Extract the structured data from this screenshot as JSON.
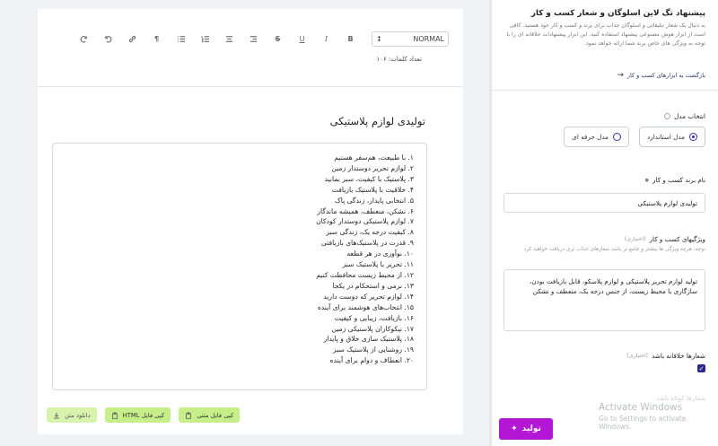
{
  "editor": {
    "toolbar": {
      "format_value": "NORMAL",
      "format_caret": "↕",
      "buttons": [
        {
          "name": "bold-button",
          "glyph": "B"
        },
        {
          "name": "italic-button",
          "glyph": "I"
        },
        {
          "name": "underline-button",
          "glyph": "U"
        },
        {
          "name": "strike-button",
          "glyph": "S"
        },
        {
          "name": "align-right-button",
          "glyph": "≡"
        },
        {
          "name": "align-center-button",
          "glyph": "≡"
        },
        {
          "name": "ordered-list-button",
          "glyph": "☰"
        },
        {
          "name": "bullet-list-button",
          "glyph": "☰"
        },
        {
          "name": "rtl-button",
          "glyph": "¶"
        },
        {
          "name": "link-button",
          "glyph": "⚭"
        },
        {
          "name": "undo-button",
          "glyph": "↶"
        },
        {
          "name": "redo-button",
          "glyph": "↷"
        }
      ]
    },
    "word_count": "تعداد کلمات: ۱۰۶",
    "doc_title": "تولیدی لوازم پلاستیکی",
    "slogans": [
      "۱. با طبیعت، هم‌سفر هستیم",
      "۲. لوازم تحریر دوستدار زمین",
      "۳. پلاستیک با کیفیت، سبز بمانید",
      "۴. خلاقیت با پلاستیک بازیافت",
      "۵. انتخابی پایدار، زندگی پاک",
      "۶. نشکن، منعطف، همیشه ماندگار",
      "۷. لوازم پلاستیکی دوستدار کودکان",
      "۸. کیفیت درجه یک، زندگی سبز",
      "۹. قدرت در پلاستیک‌های بازیافتی",
      "۱۰. نوآوری در هر قطعه",
      "۱۱. تحریر با پلاستیک سبز",
      "۱۲. از محیط زیست محافظت کنیم",
      "۱۳. نرمی و استحکام در یکجا",
      "۱۴. لوازم تحریر که دوست دارید",
      "۱۵. انتخاب‌های هوشمند برای آینده",
      "۱۶. بازیافت، زیبایی و کیفیت",
      "۱۷. نیکوکاران پلاستیکی زمین",
      "۱۸. پلاستیک سازی خلاق و پایدار",
      "۱۹. روشنایی از پلاستیک سبز",
      "۲۰. انعطاف و دوام برای آینده"
    ],
    "actions": {
      "copy_text": "کپی فایل متنی",
      "copy_html": "کپی فایل HTML",
      "download_text": "دانلود متن"
    }
  },
  "sidebar": {
    "title": "پیشنهاد تگ لاین اسلوگان و شعار کسب و کار",
    "description": "به دنبال یک شعار تبلیغاتی و اسلوگان جذاب برای برند و کسب و کار خود هستید. کافی است از ابزار هوش مصنوعی پیشنهاد استفاده کنید. این ابزار پیشنهادات خلاقانه ای را با توجه به ویژگی های خاص برند شما ارائه خواهد نمود.",
    "back_link": "بازگشت به ابزارهای کسب و کار",
    "model_label": "انتخاب مدل",
    "model_options": {
      "standard": "مدل استاندارد",
      "pro": "مدل حرفه ای"
    },
    "brand_label": "نام برند کسب و کار",
    "brand_value": "تولیدی لوازم پلاستیکی",
    "features_label": "ویژگیهای کسب و کار",
    "features_optional": "(اختیاری)",
    "features_hint": "توجه: هرچه ویژگی ها بیشتر و جامع تر باشد شعارهای جذاب تری دریافت خواهید کرد",
    "features_value": "تولید لوازم تحریر پلاستیکی و لوازم پلاسکو، قابل بازیافت بودن، سازگاری با محیط زیست، از جنس درجه یک، منعطف و نشکن",
    "creative_label": "شعارها خلاقانه باشد",
    "creative_optional": "(اختیاری)",
    "creative_checked": true,
    "faded_next": "شعارها کوتاه باشد",
    "generate": "تولید"
  },
  "watermark": {
    "line1": "Activate Windows",
    "line2": "Go to Settings to activate Windows."
  }
}
